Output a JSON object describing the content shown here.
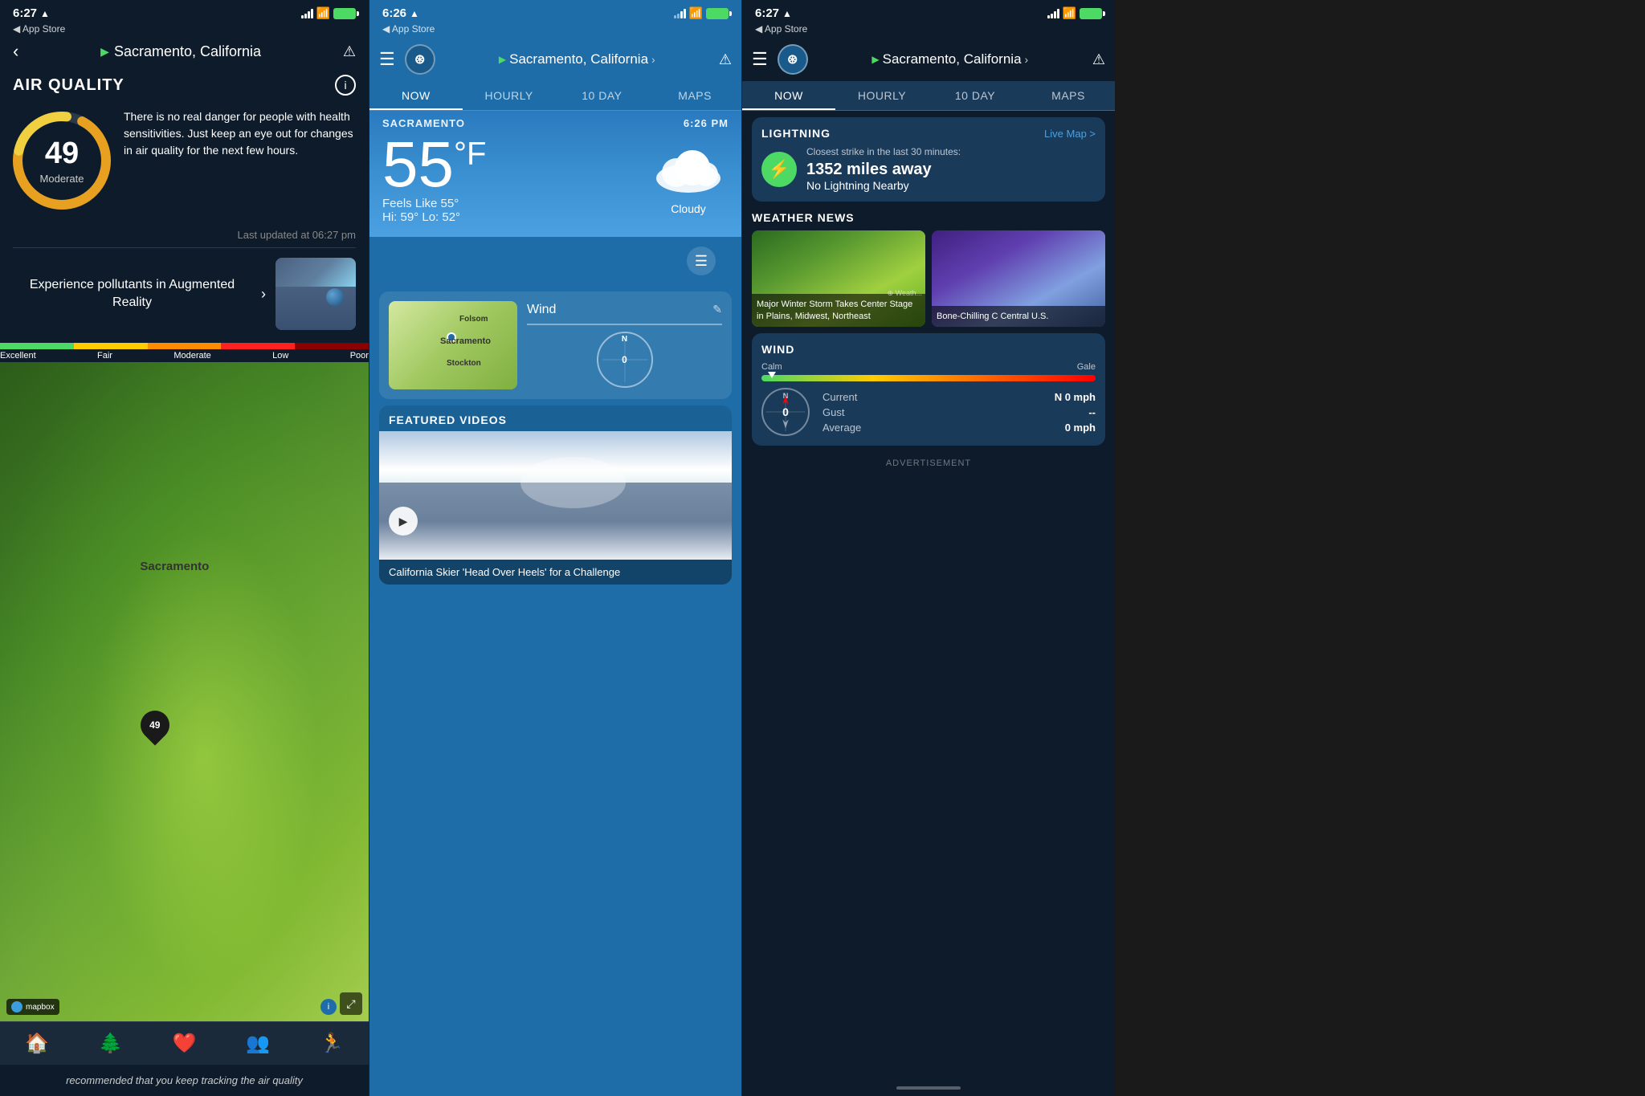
{
  "panel1": {
    "status_time": "6:27",
    "store_label": "App Store",
    "location": "Sacramento, California",
    "air_quality": {
      "title": "AIR QUALITY",
      "aqi_value": "49",
      "aqi_label": "Moderate",
      "description": "There is no real danger for people with health sensitivities. Just keep an eye out for changes in air quality for the next few hours.",
      "last_updated": "Last updated at 06:27 pm",
      "ar_banner_text": "Experience pollutants in Augmented Reality",
      "scale_labels": [
        "Excellent",
        "Fair",
        "Moderate",
        "Low",
        "Poor"
      ],
      "map_label": "Sacramento",
      "map_aqi": "49"
    },
    "bottom_nav": [
      "🏠",
      "🌲",
      "❤️",
      "👥",
      "🏃"
    ],
    "bottom_text": "recommended that you keep tracking the air quality"
  },
  "panel2": {
    "status_time": "6:26",
    "store_label": "App Store",
    "location": "Sacramento, California",
    "tabs": [
      "NOW",
      "HOURLY",
      "10 DAY",
      "MAPS"
    ],
    "active_tab": "NOW",
    "city": "SACRAMENTO",
    "time_display": "6:26 PM",
    "temperature": "55",
    "temp_unit": "°F",
    "feels_like": "Feels Like 55°",
    "hi_lo": "Hi: 59° Lo: 52°",
    "condition": "Cloudy",
    "wind_title": "Wind",
    "wind_value": "0",
    "featured_videos_title": "FEATURED VIDEOS",
    "video_caption": "California Skier 'Head Over Heels' for a Challenge"
  },
  "panel3": {
    "status_time": "6:27",
    "store_label": "App Store",
    "location": "Sacramento, California",
    "tabs": [
      "NOW",
      "HOURLY",
      "10 DAY",
      "MAPS"
    ],
    "active_tab": "NOW",
    "lightning": {
      "title": "LIGHTNING",
      "live_map": "Live Map >",
      "subtitle": "Closest strike in the last 30 minutes:",
      "distance": "1352 miles away",
      "status": "No Lightning Nearby"
    },
    "weather_news": {
      "title": "WEATHER NEWS",
      "article1": "Major Winter Storm Takes Center Stage in Plains, Midwest, Northeast",
      "article2": "Bone-Chilling C Central U.S."
    },
    "wind": {
      "title": "WIND",
      "scale_calm": "Calm",
      "scale_gale": "Gale",
      "current_label": "Current",
      "current_value": "N 0 mph",
      "gust_label": "Gust",
      "gust_value": "--",
      "average_label": "Average",
      "average_value": "0  mph"
    },
    "advertisement": "ADVERTISEMENT"
  }
}
